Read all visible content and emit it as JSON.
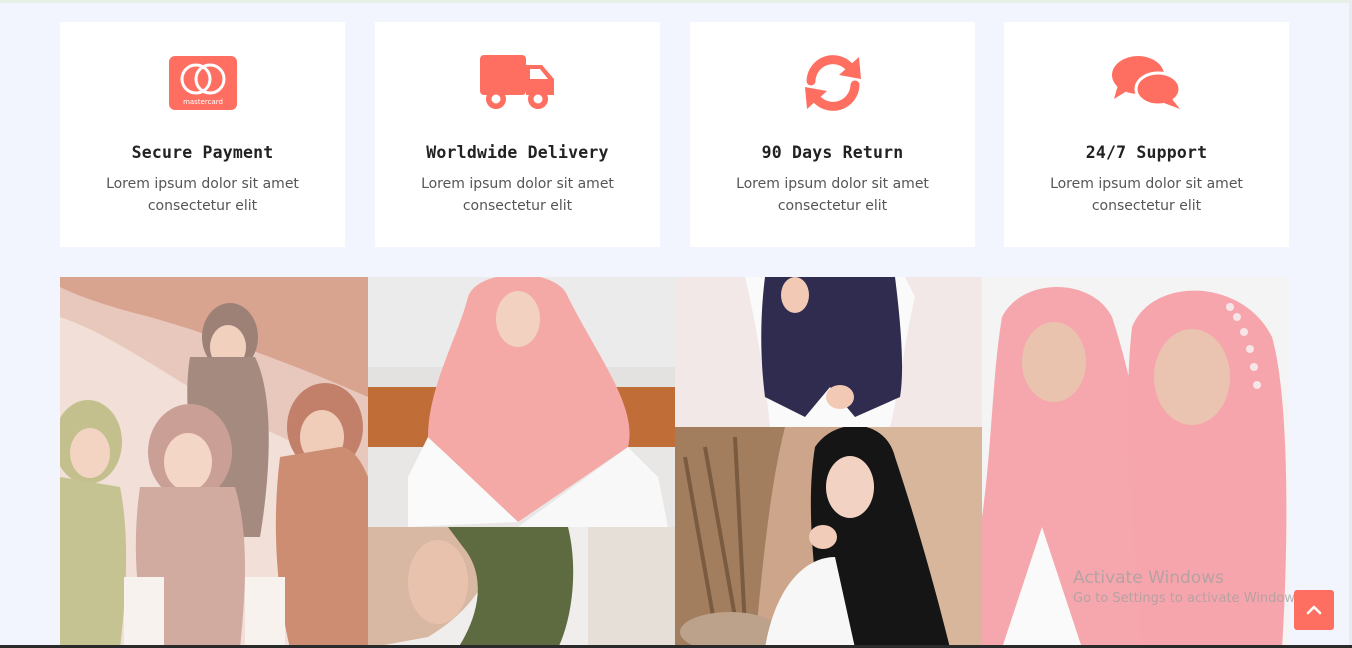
{
  "theme": {
    "accent": "#fe6f61",
    "background": "#f3f5fe",
    "card": "#ffffff"
  },
  "features": [
    {
      "icon": "mastercard-icon",
      "icon_text": "mastercard",
      "title": "Secure Payment",
      "desc": "Lorem ipsum dolor sit amet consectetur elit"
    },
    {
      "icon": "truck-icon",
      "title": "Worldwide Delivery",
      "desc": "Lorem ipsum dolor sit amet consectetur elit"
    },
    {
      "icon": "sync-icon",
      "title": "90 Days Return",
      "desc": "Lorem ipsum dolor sit amet consectetur elit"
    },
    {
      "icon": "comments-icon",
      "title": "24/7 Support",
      "desc": "Lorem ipsum dolor sit amet consectetur elit"
    }
  ],
  "gallery": [
    {
      "name": "hijab-group-photo"
    },
    {
      "name": "pink-hijab-photo"
    },
    {
      "name": "olive-hijab-photo"
    },
    {
      "name": "navy-hijab-photo"
    },
    {
      "name": "black-hijab-photo"
    },
    {
      "name": "pink-embellished-hijab-photo"
    }
  ],
  "watermark": {
    "line1": "Activate Windows",
    "line2": "Go to Settings to activate Windows."
  },
  "back_to_top": {
    "icon": "chevron-up-icon"
  }
}
